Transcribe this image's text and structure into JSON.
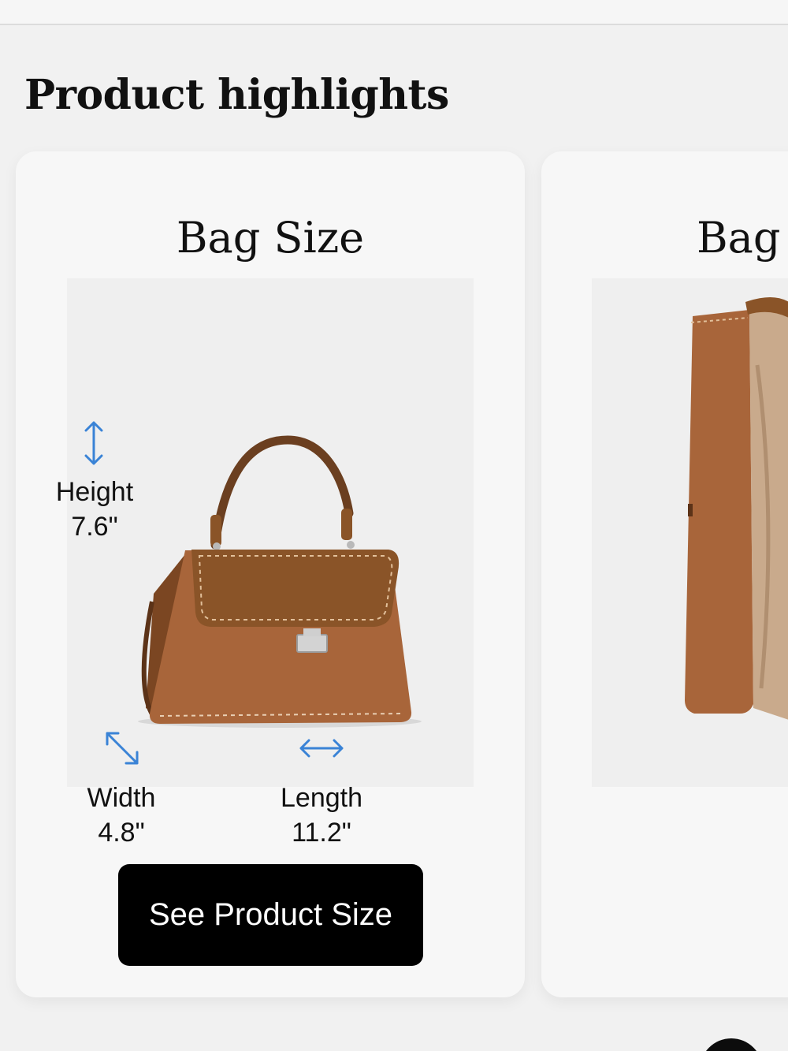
{
  "section": {
    "title": "Product highlights"
  },
  "cards": [
    {
      "title": "Bag Size",
      "dimensions": {
        "height": {
          "label": "Height",
          "value": "7.6\""
        },
        "width": {
          "label": "Width",
          "value": "4.8\""
        },
        "length": {
          "label": "Length",
          "value": "11.2\""
        }
      },
      "button_label": "See Product Size"
    },
    {
      "title": "Bag S"
    }
  ],
  "colors": {
    "accent_icon": "#3a83d6",
    "leather": "#a8653a",
    "suede": "#8a5428",
    "button_bg": "#000000"
  },
  "icons": [
    "vertical-arrow-icon",
    "diagonal-arrow-icon",
    "horizontal-arrow-icon"
  ]
}
